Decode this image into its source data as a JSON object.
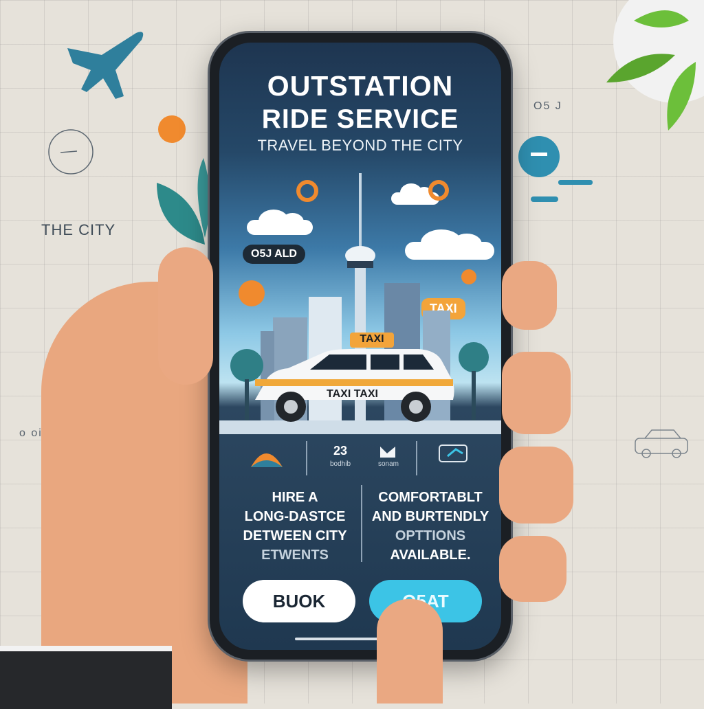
{
  "background": {
    "left_label": "THE CITY",
    "top_right_code": "O5 J",
    "left_bottom_code": "o  oi6d",
    "icons": [
      "plane-icon",
      "compass-icon",
      "plant-icon",
      "leaf-icon",
      "map-pin-icon",
      "car-sketch-icon"
    ]
  },
  "screen": {
    "title_line1": "OUTSTATION",
    "title_line2": "RIDE SERVICE",
    "subtitle": "TRAVEL BEYOND THE CITY",
    "badge_left": "O5J ALD",
    "badge_taxi": "TAXI",
    "car_roof_sign": "TAXI",
    "car_door_text": "TAXI TAXI",
    "feature_icons": [
      {
        "icon": "sunset-icon",
        "label": "......."
      },
      {
        "icon": "counter-icon",
        "value": "23",
        "label": "bodhib"
      },
      {
        "icon": "seat-icon",
        "label": "sonam"
      },
      {
        "icon": "card-icon",
        "label": "......."
      }
    ],
    "feature_left": [
      "HIRE A",
      "LONG-DASTCE",
      "DETWEEN CITY",
      "ETWENTS"
    ],
    "feature_right": [
      "COMFORTABLT",
      "AND BURTENDLY",
      "OPTTIONS",
      "AVAILABLE."
    ],
    "button_book": "BUOK",
    "button_secondary": "O5AT"
  },
  "colors": {
    "accent_orange": "#f08a2e",
    "taxi_yellow": "#f3a43a",
    "button_cyan": "#3cc4e6",
    "screen_dark": "#1f3850"
  }
}
